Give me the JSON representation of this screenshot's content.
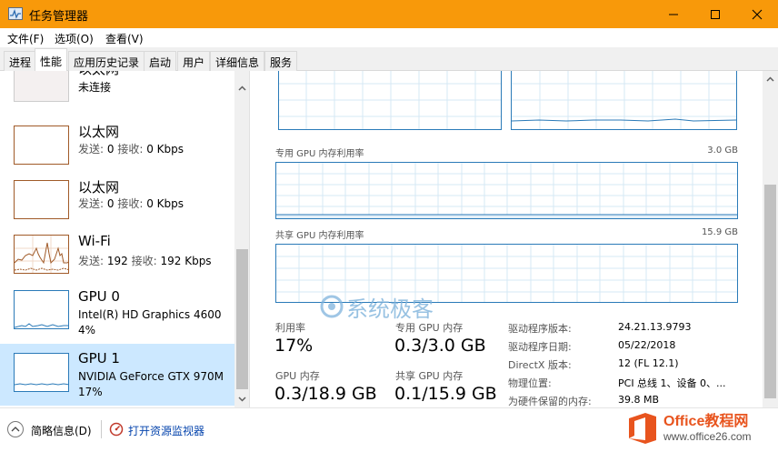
{
  "window": {
    "title": "任务管理器"
  },
  "menu": [
    "文件(F)",
    "选项(O)",
    "查看(V)"
  ],
  "tabs": [
    "进程",
    "性能",
    "应用历史记录",
    "启动",
    "用户",
    "详细信息",
    "服务"
  ],
  "active_tab": "性能",
  "resources": [
    {
      "name": "以太网",
      "sub": "未连接"
    },
    {
      "name": "以太网",
      "sub_send_label": "发送:",
      "sub_send": "0",
      "sub_recv_label": "接收:",
      "sub_recv": "0 Kbps"
    },
    {
      "name": "以太网",
      "sub_send_label": "发送:",
      "sub_send": "0",
      "sub_recv_label": "接收:",
      "sub_recv": "0 Kbps"
    },
    {
      "name": "Wi-Fi",
      "sub_send_label": "发送:",
      "sub_send": "192",
      "sub_recv_label": "接收:",
      "sub_recv": "192 Kbps"
    },
    {
      "name": "GPU 0",
      "sub": "Intel(R) HD Graphics 4600",
      "sub2": "4%"
    },
    {
      "name": "GPU 1",
      "sub": "NVIDIA GeForce GTX 970M",
      "sub2": "17%"
    }
  ],
  "selected_resource_index": 5,
  "graphs": {
    "dedicated_label": "专用 GPU 内存利用率",
    "dedicated_max": "3.0 GB",
    "shared_label": "共享 GPU 内存利用率",
    "shared_max": "15.9 GB"
  },
  "stats": [
    {
      "label": "利用率",
      "value": "17%"
    },
    {
      "label": "专用 GPU 内存",
      "value": "0.3/3.0 GB"
    },
    {
      "label": "GPU 内存",
      "value": "0.3/18.9 GB"
    },
    {
      "label": "共享 GPU 内存",
      "value": "0.1/15.9 GB"
    }
  ],
  "info": [
    {
      "label": "驱动程序版本:",
      "value": "24.21.13.9793"
    },
    {
      "label": "驱动程序日期:",
      "value": "05/22/2018"
    },
    {
      "label": "DirectX 版本:",
      "value": "12 (FL 12.1)"
    },
    {
      "label": "物理位置:",
      "value": "PCI 总线 1、设备 0、..."
    },
    {
      "label": "为硬件保留的内存:",
      "value": "39.8 MB"
    }
  ],
  "footer": {
    "summary": "简略信息(D)",
    "resmon": "打开资源监视器"
  },
  "watermarks": {
    "center": "系统极客",
    "brand_main": "Office教程网",
    "brand_url": "www.office26.com"
  },
  "colors": {
    "titlebar": "#f8990a",
    "gpu_graph": "#2a7ab8",
    "net_graph": "#a05a28",
    "selected": "#cce8ff",
    "office_red": "#e8541e"
  }
}
